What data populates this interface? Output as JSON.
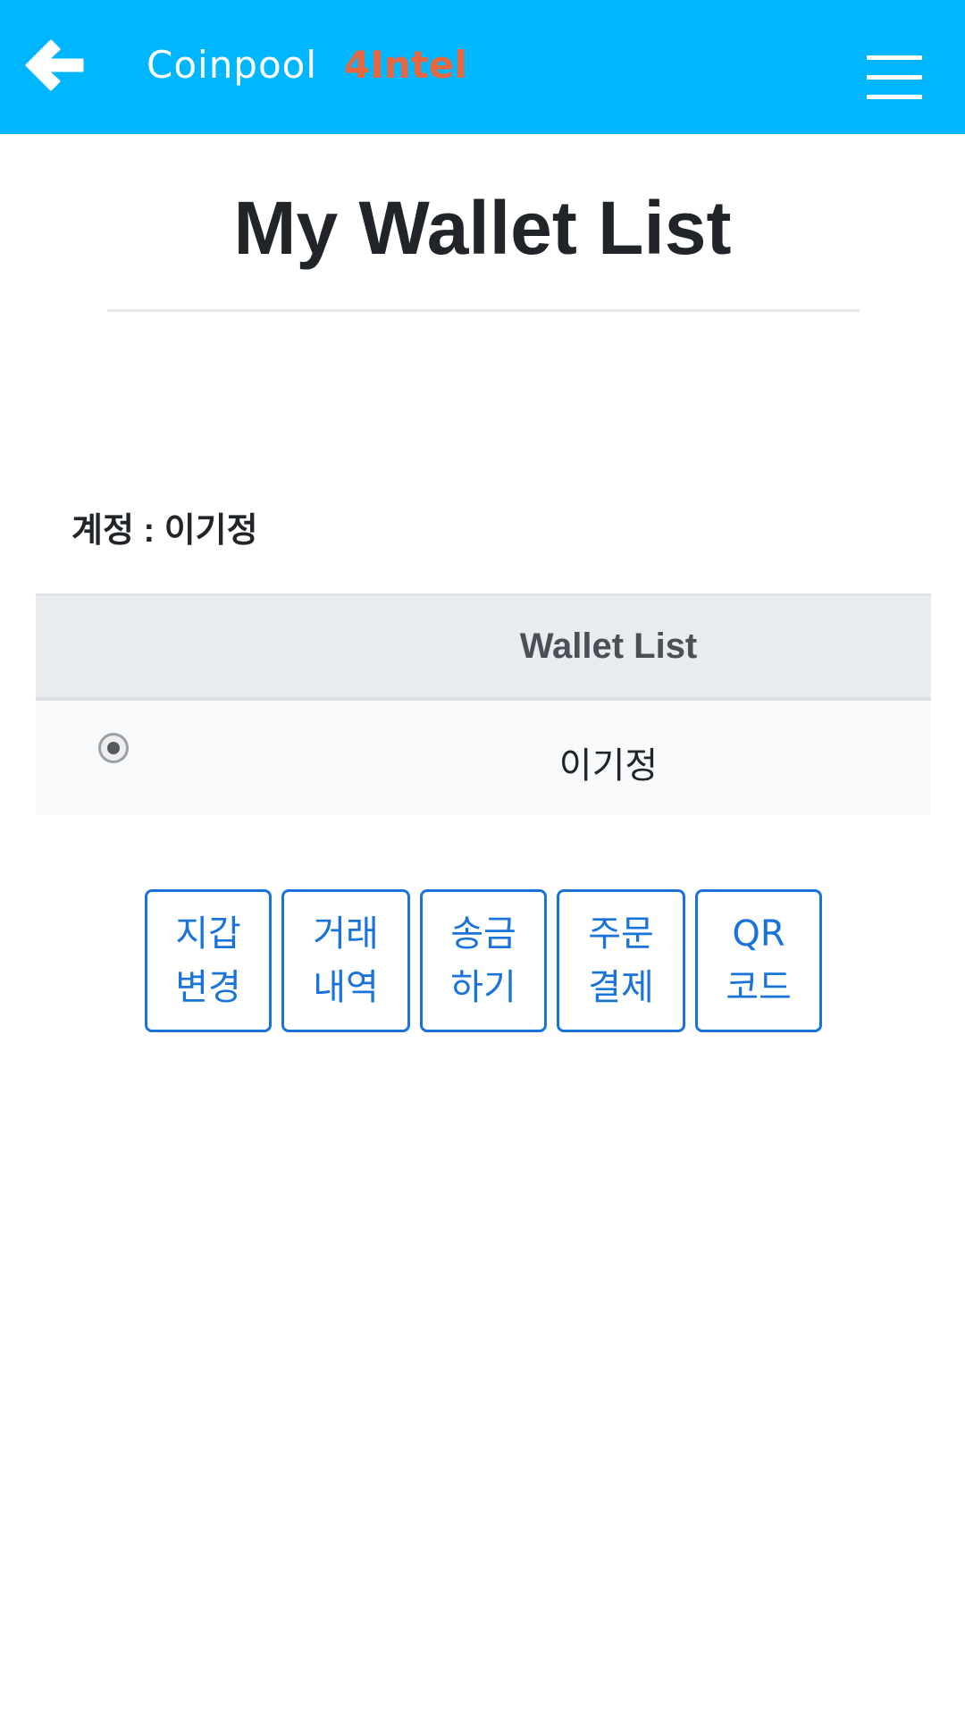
{
  "header": {
    "app_name": "Coinpool",
    "app_tag": "4Intel",
    "back_icon": "arrow-left-icon",
    "menu_icon": "hamburger-menu-icon",
    "background_color": "#00b7ff",
    "tag_color": "#e8663d"
  },
  "page": {
    "title": "My Wallet List"
  },
  "account": {
    "label": "계정 : 이기정"
  },
  "wallet_table": {
    "header": "Wallet List",
    "rows": [
      {
        "selected": true,
        "name": "이기정"
      }
    ]
  },
  "actions": [
    {
      "label": "지갑\n변경"
    },
    {
      "label": "거래\n내역"
    },
    {
      "label": "송금\n하기"
    },
    {
      "label": "주문\n결제"
    },
    {
      "label": "QR\n코드"
    }
  ],
  "colors": {
    "accent_blue": "#1a73d9"
  }
}
